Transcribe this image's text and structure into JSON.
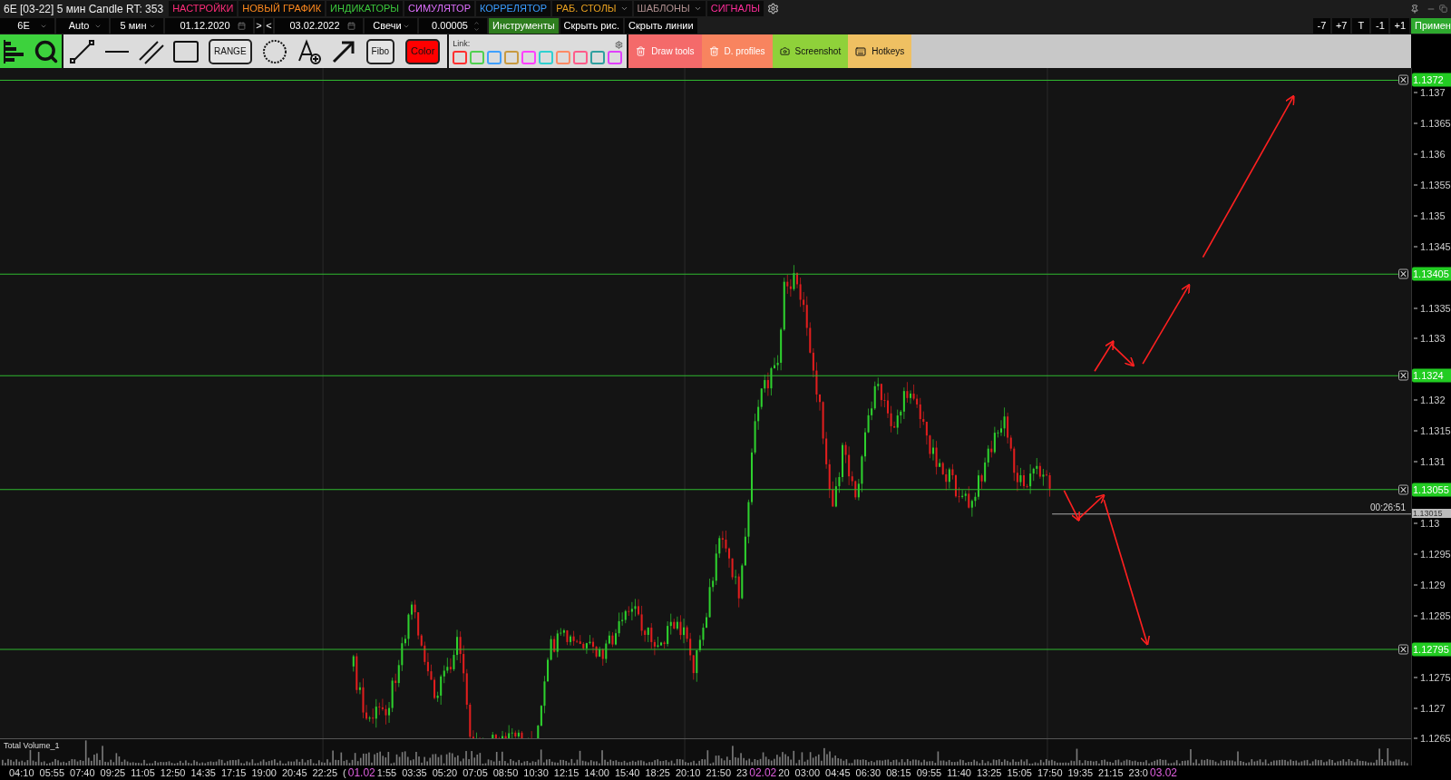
{
  "title": "6E [03-22] 5 мин Candle RT: 353",
  "menu": [
    {
      "label": "НАСТРОЙКИ",
      "color": "#ff2d7a",
      "dropdown": false
    },
    {
      "label": "НОВЫЙ ГРАФИК",
      "color": "#ff8a1e",
      "dropdown": false
    },
    {
      "label": "ИНДИКАТОРЫ",
      "color": "#3cc83c",
      "dropdown": false
    },
    {
      "label": "СИМУЛЯТОР",
      "color": "#e070ff",
      "dropdown": false
    },
    {
      "label": "КОРРЕЛЯТОР",
      "color": "#3a9cff",
      "dropdown": false
    },
    {
      "label": "РАБ. СТОЛЫ",
      "color": "#e8a020",
      "dropdown": true
    },
    {
      "label": "ШАБЛОНЫ",
      "color": "#b09090",
      "dropdown": true
    },
    {
      "label": "СИГНАЛЫ",
      "color": "#ff2d9a",
      "dropdown": false
    }
  ],
  "controls": [
    {
      "kind": "select",
      "value": "6E"
    },
    {
      "kind": "select",
      "value": "Auto"
    },
    {
      "kind": "select",
      "value": "5 мин"
    },
    {
      "kind": "date",
      "value": "01.12.2020"
    },
    {
      "kind": "step",
      "value": ">"
    },
    {
      "kind": "step",
      "value": "<"
    },
    {
      "kind": "date",
      "value": "03.02.2022"
    },
    {
      "kind": "select",
      "value": "Свечи"
    },
    {
      "kind": "spinner",
      "value": "0.00005"
    }
  ],
  "toggles": [
    {
      "label": "Инструменты",
      "selected": true
    },
    {
      "label": "Скрыть рис.",
      "selected": false
    },
    {
      "label": "Скрыть линии",
      "selected": false
    }
  ],
  "step_buttons": [
    "-7",
    "+7",
    "T",
    "-1",
    "+1"
  ],
  "apply_button": "Примен",
  "tools": [
    {
      "kind": "bars",
      "selected": true
    },
    {
      "kind": "search",
      "selected": true
    },
    {
      "kind": "segment",
      "selected": false
    },
    {
      "kind": "hline",
      "selected": false
    },
    {
      "kind": "channel",
      "selected": false
    },
    {
      "kind": "rect",
      "selected": false
    },
    {
      "kind": "text",
      "label": "RANGE",
      "selected": false
    },
    {
      "kind": "circle",
      "selected": false
    },
    {
      "kind": "textadd",
      "selected": false
    },
    {
      "kind": "arrow",
      "selected": false
    },
    {
      "kind": "text",
      "label": "Fibo",
      "selected": false
    },
    {
      "kind": "color",
      "label": "Color",
      "selected": false
    }
  ],
  "link": {
    "label": "Link:",
    "colors": [
      {
        "color": "#ff3030"
      },
      {
        "color": "#50d050"
      },
      {
        "color": "#40a0ff"
      },
      {
        "color": "#c89a40"
      },
      {
        "color": "#ff40ff"
      },
      {
        "color": "#30d0d0"
      },
      {
        "color": "#ff8a65"
      },
      {
        "color": "#ff5c8a"
      },
      {
        "color": "#30a0a0"
      },
      {
        "color": "#e040fb"
      }
    ]
  },
  "actions": [
    {
      "label": "Draw tools",
      "color": "#f46a6a",
      "kind": "trash"
    },
    {
      "label": "D. profiles",
      "color": "#f8845f",
      "kind": "profiles"
    },
    {
      "label": "Screenshot",
      "color": "#8fd13a",
      "kind": "camera"
    },
    {
      "label": "Hotkeys",
      "color": "#efc062",
      "kind": "keyboard"
    }
  ],
  "chart": {
    "price_ticks": [
      "1.137",
      "1.1365",
      "1.136",
      "1.1355",
      "1.135",
      "1.1345",
      "1.1335",
      "1.133",
      "1.132",
      "1.1315",
      "1.131",
      "1.13",
      "1.1295",
      "1.129",
      "1.1285",
      "1.1275",
      "1.127",
      "1.1265"
    ],
    "levels": [
      {
        "label": "1.1372"
      },
      {
        "label": "1.13405"
      },
      {
        "label": "1.1324"
      },
      {
        "label": "1.13055"
      },
      {
        "label": "1.12795"
      }
    ],
    "last_price": {
      "label": "1.13015",
      "timer": "00:26:51"
    },
    "volume_label": "Total Volume_1",
    "time_labels": [
      {
        "label": "04:10",
        "kind": "time"
      },
      {
        "label": "05:55",
        "kind": "time"
      },
      {
        "label": "07:40",
        "kind": "time"
      },
      {
        "label": "09:25",
        "kind": "time"
      },
      {
        "label": "11:05",
        "kind": "time"
      },
      {
        "label": "12:50",
        "kind": "time"
      },
      {
        "label": "14:35",
        "kind": "time"
      },
      {
        "label": "17:15",
        "kind": "time"
      },
      {
        "label": "19:00",
        "kind": "time"
      },
      {
        "label": "20:45",
        "kind": "time"
      },
      {
        "label": "22:25",
        "kind": "time"
      },
      {
        "label": "(",
        "kind": "time"
      },
      {
        "label": "01.02",
        "kind": "date"
      },
      {
        "label": "1:55",
        "kind": "time"
      },
      {
        "label": "03:35",
        "kind": "time"
      },
      {
        "label": "05:20",
        "kind": "time"
      },
      {
        "label": "07:05",
        "kind": "time"
      },
      {
        "label": "08:50",
        "kind": "time"
      },
      {
        "label": "10:30",
        "kind": "time"
      },
      {
        "label": "12:15",
        "kind": "time"
      },
      {
        "label": "14:00",
        "kind": "time"
      },
      {
        "label": "15:40",
        "kind": "time"
      },
      {
        "label": "18:25",
        "kind": "time"
      },
      {
        "label": "20:10",
        "kind": "time"
      },
      {
        "label": "21:50",
        "kind": "time"
      },
      {
        "label": "23",
        "kind": "time"
      },
      {
        "label": "02.02",
        "kind": "date"
      },
      {
        "label": "20",
        "kind": "time"
      },
      {
        "label": "03:00",
        "kind": "time"
      },
      {
        "label": "04:45",
        "kind": "time"
      },
      {
        "label": "06:30",
        "kind": "time"
      },
      {
        "label": "08:15",
        "kind": "time"
      },
      {
        "label": "09:55",
        "kind": "time"
      },
      {
        "label": "11:40",
        "kind": "time"
      },
      {
        "label": "13:25",
        "kind": "time"
      },
      {
        "label": "15:05",
        "kind": "time"
      },
      {
        "label": "17:50",
        "kind": "time"
      },
      {
        "label": "19:35",
        "kind": "time"
      },
      {
        "label": "21:15",
        "kind": "time"
      },
      {
        "label": "23:0",
        "kind": "time"
      },
      {
        "label": "03.02",
        "kind": "date"
      }
    ]
  }
}
